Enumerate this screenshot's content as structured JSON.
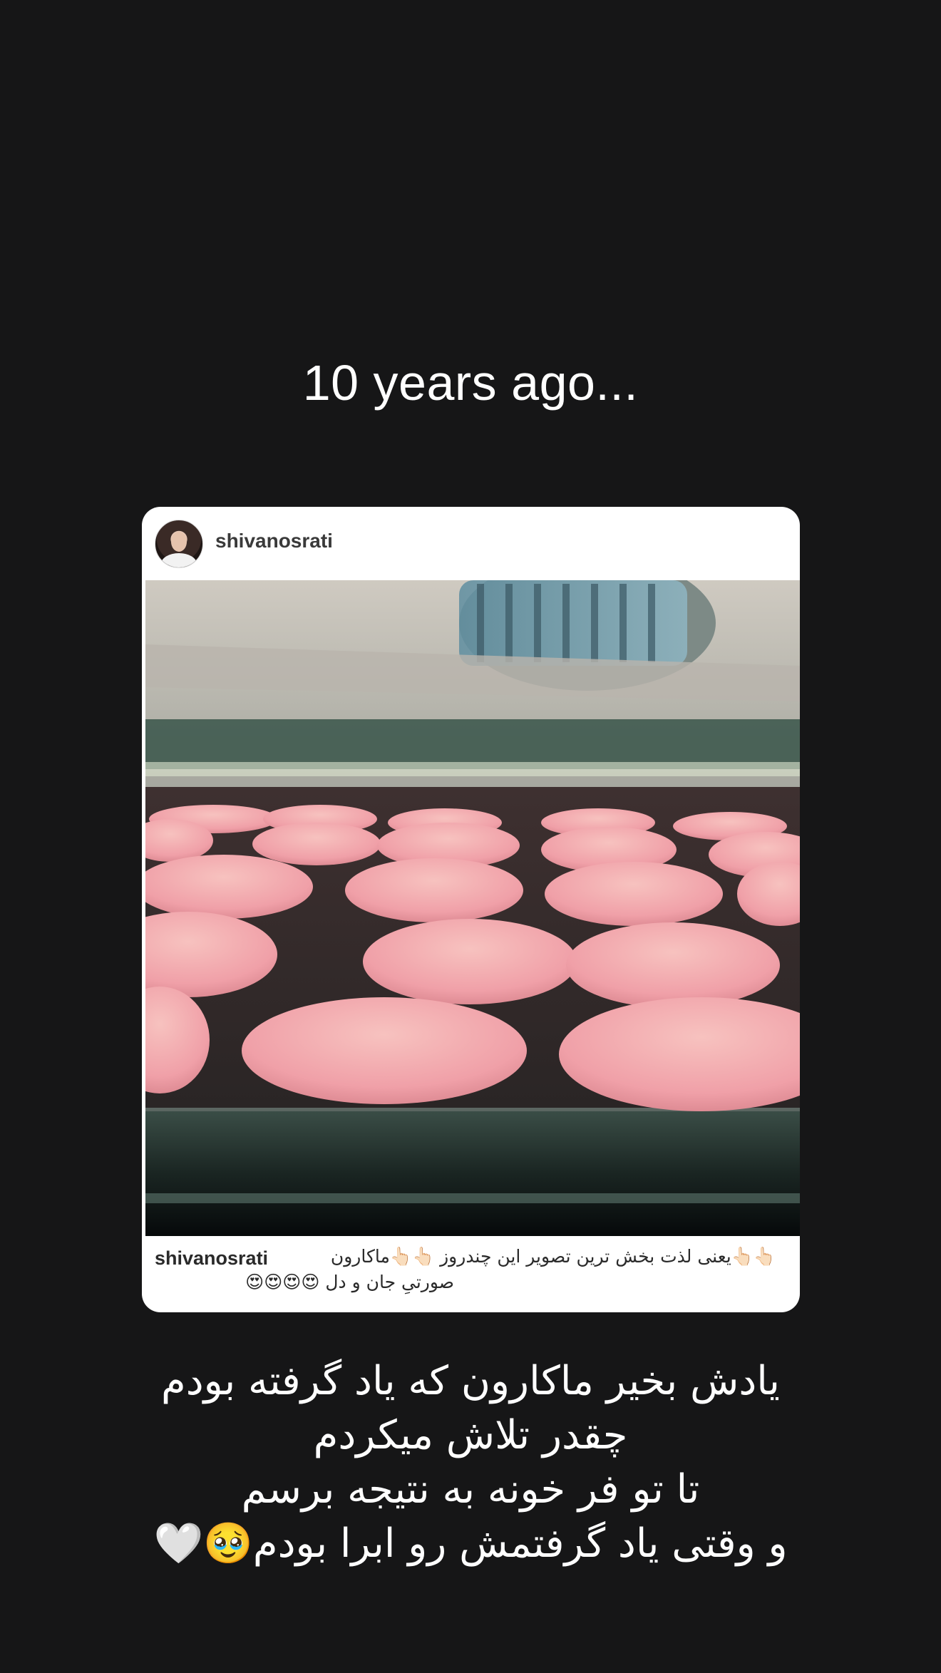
{
  "story": {
    "header_text": "10 years ago...",
    "post": {
      "username": "shivanosrati",
      "avatar_icon": "profile-avatar",
      "image_description_icon": "macarons-in-oven-photo",
      "caption_username": "shivanosrati",
      "caption_line1": "👆🏻👆🏻یعنی لذت بخش ترین تصویر این چندروز 👆🏻👆🏻ماکارون",
      "caption_line2": "صورتیِ جان و دل 😍😍😍😍"
    },
    "text_lines": [
      "یادش بخیر ماکارون که یاد گرفته بودم",
      "چقدر تلاش میکردم",
      "تا تو فر خونه به نتیجه برسم",
      "و وقتی یاد گرفتمش رو ابرا بودم🥹🤍"
    ],
    "colors": {
      "background": "#161617",
      "card": "#ffffff",
      "text": "#ffffff",
      "macaron_pink": "#f2a2ae"
    }
  }
}
